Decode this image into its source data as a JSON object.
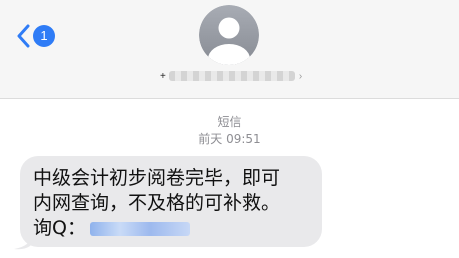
{
  "header": {
    "back_badge_count": "1",
    "contact_prefix": "+",
    "contact_chevron": "›",
    "accent_color": "#2f7cf6"
  },
  "conversation": {
    "service_label": "短信",
    "timestamp": "前天 09:51"
  },
  "message": {
    "line1": "中级会计初步阅卷完毕，即可",
    "line2": "内网查询，不及格的可补救。",
    "line3": "询Q："
  },
  "icons": {
    "back": "chevron-left-icon",
    "avatar": "person-silhouette-icon"
  }
}
